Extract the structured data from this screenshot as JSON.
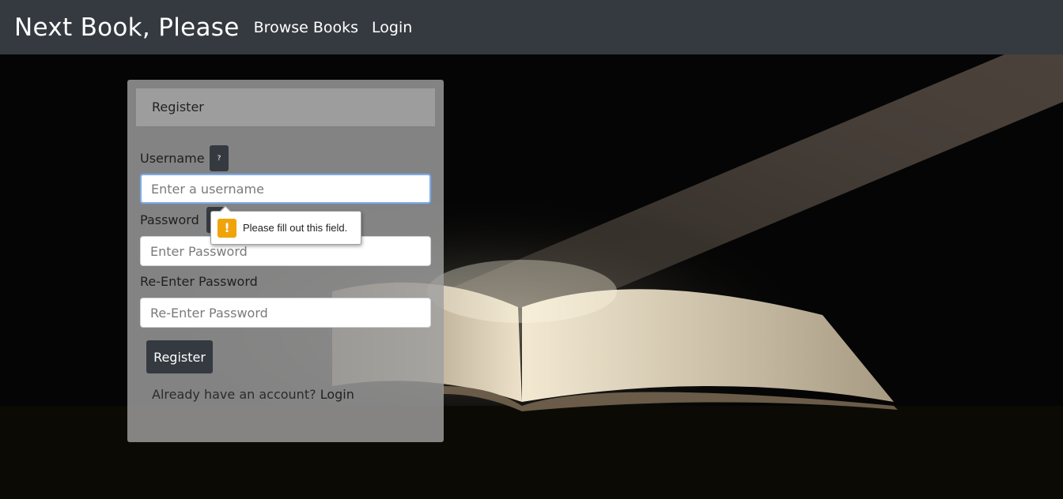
{
  "navbar": {
    "brand": "Next Book, Please",
    "links": [
      {
        "label": "Browse Books"
      },
      {
        "label": "Login"
      }
    ]
  },
  "register_card": {
    "header": "Register",
    "fields": {
      "username": {
        "label": "Username",
        "help": "?",
        "placeholder": "Enter a username",
        "value": ""
      },
      "password": {
        "label": "Password",
        "help": "?",
        "placeholder": "Enter Password",
        "value": ""
      },
      "confirm": {
        "label": "Re-Enter Password",
        "placeholder": "Re-Enter Password",
        "value": ""
      }
    },
    "submit_label": "Register",
    "footer": {
      "text": "Already have an account?",
      "link": "Login"
    }
  },
  "validation_tooltip": {
    "icon": "warning-icon",
    "symbol": "!",
    "message": "Please fill out this field."
  },
  "colors": {
    "navbar": "#343a40",
    "button": "#343a40",
    "focus_border": "#80abe0",
    "warning": "#f0a30a"
  }
}
